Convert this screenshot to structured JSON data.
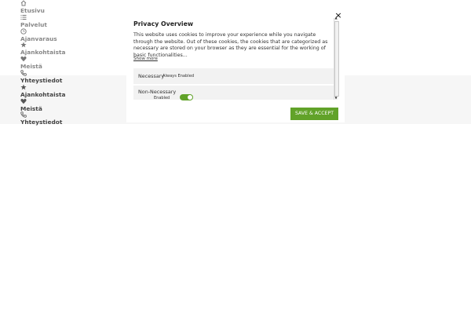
{
  "nav": {
    "items": [
      {
        "icon": "home-icon",
        "label": "Etusivu"
      },
      {
        "icon": "list-icon",
        "label": "Palvelut"
      },
      {
        "icon": "clock-icon",
        "label": "Ajanvaraus"
      },
      {
        "icon": "star-icon",
        "label": "Ajankohtaista"
      },
      {
        "icon": "heart-icon",
        "label": "Meistä"
      },
      {
        "icon": "phone-icon",
        "label": "Yhteystiedot"
      },
      {
        "icon": "star-icon",
        "label": "Ajankohtaista"
      },
      {
        "icon": "heart-icon",
        "label": "Meistä"
      },
      {
        "icon": "phone-icon",
        "label": "Yhteystiedot"
      }
    ]
  },
  "modal": {
    "title": "Privacy Overview",
    "close_label": "×",
    "description": "This website uses cookies to improve your experience while you navigate through the website. Out of these cookies, the cookies that are categorized as necessary are stored on your browser as they are essential for the working of basic functionalities...",
    "show_more": "Show more",
    "categories": [
      {
        "name": "Necessary",
        "badge": "Always Enabled"
      },
      {
        "name": "Non-Necessary",
        "toggle_label": "Enabled",
        "toggle_on": true
      }
    ],
    "save_label": "SAVE & ACCEPT"
  },
  "colors": {
    "accent": "#61a229",
    "band": "#f6f6f6"
  }
}
